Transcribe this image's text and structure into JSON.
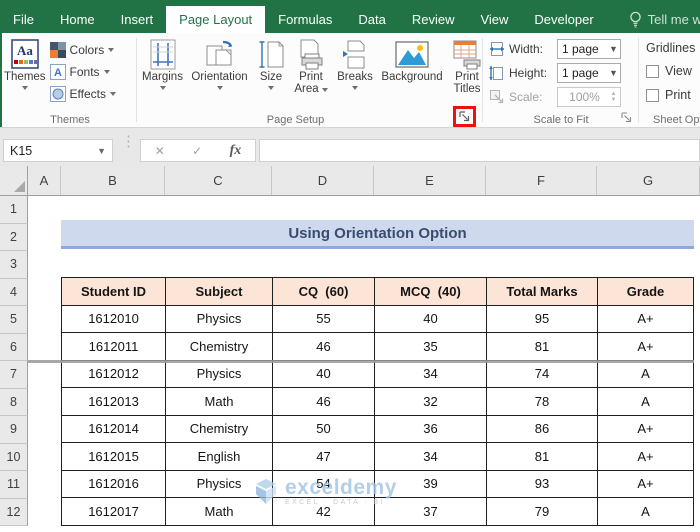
{
  "tabs": [
    {
      "label": "File",
      "active": false
    },
    {
      "label": "Home",
      "active": false
    },
    {
      "label": "Insert",
      "active": false
    },
    {
      "label": "Page Layout",
      "active": true
    },
    {
      "label": "Formulas",
      "active": false
    },
    {
      "label": "Data",
      "active": false
    },
    {
      "label": "Review",
      "active": false
    },
    {
      "label": "View",
      "active": false
    },
    {
      "label": "Developer",
      "active": false
    }
  ],
  "tell_me": {
    "label": "Tell me what y"
  },
  "ribbon": {
    "groups": {
      "themes": {
        "caption": "Themes",
        "themes_button": "Themes",
        "colors_button": "Colors",
        "fonts_button": "Fonts",
        "effects_button": "Effects"
      },
      "page_setup": {
        "caption": "Page Setup",
        "margins": "Margins",
        "orientation": "Orientation",
        "size": "Size",
        "print_area_line1": "Print",
        "print_area_line2": "Area",
        "breaks": "Breaks",
        "background": "Background",
        "print_titles_line1": "Print",
        "print_titles_line2": "Titles"
      },
      "scale_to_fit": {
        "caption": "Scale to Fit",
        "width_label": "Width:",
        "width_value": "1 page",
        "height_label": "Height:",
        "height_value": "1 page",
        "scale_label": "Scale:",
        "scale_value": "100%"
      },
      "sheet_options": {
        "caption": "Sheet Opt",
        "heading": "Gridlines",
        "view_label": "View",
        "print_label": "Print",
        "view_checked": false,
        "print_checked": false
      }
    }
  },
  "formula_bar": {
    "name_box": "K15",
    "cancel_glyph": "✕",
    "enter_glyph": "✓",
    "fx_label": "fx",
    "formula_value": ""
  },
  "sheet": {
    "column_headers": [
      "A",
      "B",
      "C",
      "D",
      "E",
      "F",
      "G"
    ],
    "row_headers": [
      "1",
      "2",
      "3",
      "4",
      "5",
      "6",
      "7",
      "8",
      "9",
      "10",
      "11",
      "12"
    ],
    "title": "Using Orientation Option",
    "table": {
      "headers": [
        "Student ID",
        "Subject",
        "CQ  (60)",
        "MCQ  (40)",
        "Total Marks",
        "Grade"
      ],
      "rows": [
        [
          "1612010",
          "Physics",
          "55",
          "40",
          "95",
          "A+"
        ],
        [
          "1612011",
          "Chemistry",
          "46",
          "35",
          "81",
          "A+"
        ],
        [
          "1612012",
          "Physics",
          "40",
          "34",
          "74",
          "A"
        ],
        [
          "1612013",
          "Math",
          "46",
          "32",
          "78",
          "A"
        ],
        [
          "1612014",
          "Chemistry",
          "50",
          "36",
          "86",
          "A+"
        ],
        [
          "1612015",
          "English",
          "47",
          "34",
          "81",
          "A+"
        ],
        [
          "1612016",
          "Physics",
          "54",
          "39",
          "93",
          "A+"
        ],
        [
          "1612017",
          "Math",
          "42",
          "37",
          "79",
          "A"
        ]
      ]
    }
  },
  "watermark": {
    "brand": "exceldemy",
    "tagline": "EXCEL · DATA · BI"
  },
  "colors": {
    "excel_green": "#217346",
    "banner_fill": "#cfd9ed",
    "banner_border": "#8ea9db",
    "table_header_fill": "#fce4d6",
    "title_text": "#3b4c70",
    "highlight_red": "#ee1111",
    "watermark_blue": "#9fc4e6"
  }
}
